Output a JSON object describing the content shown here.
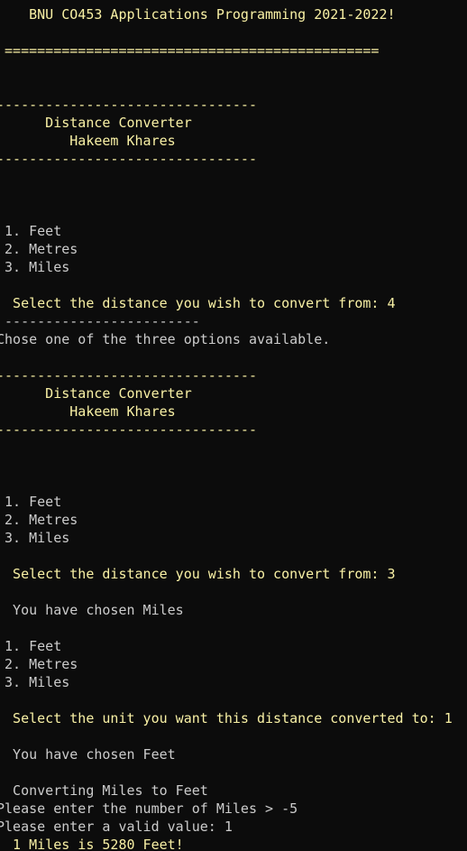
{
  "console": {
    "lines": [
      {
        "text": "==============================================",
        "color": "yellow"
      },
      {
        "text": "    BNU CO453 Applications Programming 2021-2022!",
        "color": "yellow"
      },
      {
        "text": "",
        "color": "gray"
      },
      {
        "text": " ==============================================",
        "color": "yellow"
      },
      {
        "text": "",
        "color": "gray"
      },
      {
        "text": "",
        "color": "gray"
      },
      {
        "text": "--------------------------------",
        "color": "yellow"
      },
      {
        "text": "      Distance Converter",
        "color": "yellow"
      },
      {
        "text": "         Hakeem Khares",
        "color": "yellow"
      },
      {
        "text": "--------------------------------",
        "color": "yellow"
      },
      {
        "text": "",
        "color": "gray"
      },
      {
        "text": "",
        "color": "gray"
      },
      {
        "text": "",
        "color": "gray"
      },
      {
        "text": " 1. Feet",
        "color": "gray"
      },
      {
        "text": " 2. Metres",
        "color": "gray"
      },
      {
        "text": " 3. Miles",
        "color": "gray"
      },
      {
        "text": "",
        "color": "gray"
      },
      {
        "text": "  Select the distance you wish to convert from: 4",
        "color": "yellow"
      },
      {
        "text": " ------------------------",
        "color": "gray"
      },
      {
        "text": "Chose one of the three options available.",
        "color": "gray"
      },
      {
        "text": "",
        "color": "gray"
      },
      {
        "text": "--------------------------------",
        "color": "yellow"
      },
      {
        "text": "      Distance Converter",
        "color": "yellow"
      },
      {
        "text": "         Hakeem Khares",
        "color": "yellow"
      },
      {
        "text": "--------------------------------",
        "color": "yellow"
      },
      {
        "text": "",
        "color": "gray"
      },
      {
        "text": "",
        "color": "gray"
      },
      {
        "text": "",
        "color": "gray"
      },
      {
        "text": " 1. Feet",
        "color": "gray"
      },
      {
        "text": " 2. Metres",
        "color": "gray"
      },
      {
        "text": " 3. Miles",
        "color": "gray"
      },
      {
        "text": "",
        "color": "gray"
      },
      {
        "text": "  Select the distance you wish to convert from: 3",
        "color": "yellow"
      },
      {
        "text": "",
        "color": "gray"
      },
      {
        "text": "  You have chosen Miles",
        "color": "gray"
      },
      {
        "text": "",
        "color": "gray"
      },
      {
        "text": " 1. Feet",
        "color": "gray"
      },
      {
        "text": " 2. Metres",
        "color": "gray"
      },
      {
        "text": " 3. Miles",
        "color": "gray"
      },
      {
        "text": "",
        "color": "gray"
      },
      {
        "text": "  Select the unit you want this distance converted to: 1",
        "color": "yellow"
      },
      {
        "text": "",
        "color": "gray"
      },
      {
        "text": "  You have chosen Feet",
        "color": "gray"
      },
      {
        "text": "",
        "color": "gray"
      },
      {
        "text": "  Converting Miles to Feet",
        "color": "gray"
      },
      {
        "text": "Please enter the number of Miles > -5",
        "color": "gray"
      },
      {
        "text": "Please enter a valid value: 1",
        "color": "gray"
      },
      {
        "text": "  1 Miles is 5280 Feet!",
        "color": "yellow"
      }
    ]
  }
}
